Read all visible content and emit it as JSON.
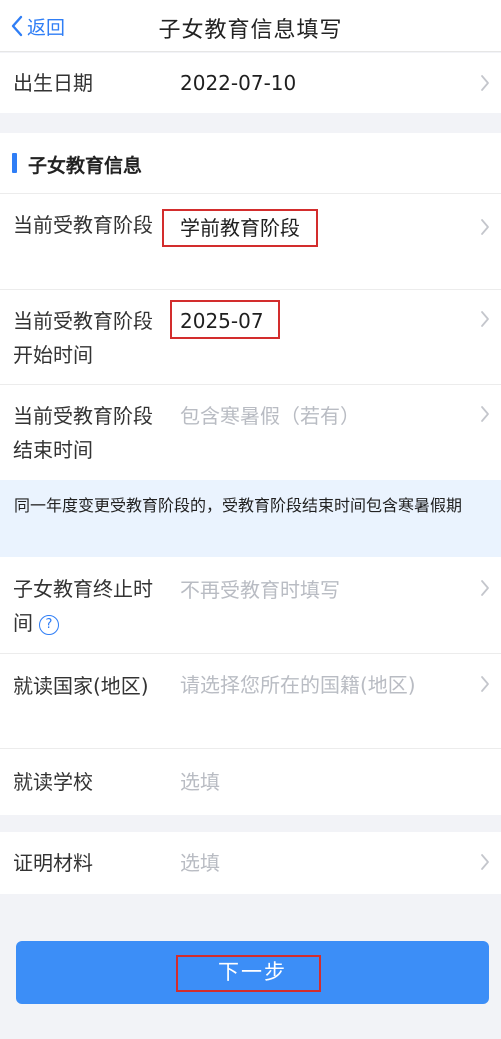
{
  "nav": {
    "back_label": "返回",
    "title": "子女教育信息填写"
  },
  "birth": {
    "label": "出生日期",
    "value": "2022-07-10"
  },
  "section": {
    "title": "子女教育信息"
  },
  "stage": {
    "label": "当前受教育阶段",
    "value": "学前教育阶段"
  },
  "stage_start": {
    "label": "当前受教育阶段开始时间",
    "value": "2025-07"
  },
  "stage_end": {
    "label": "当前受教育阶段结束时间",
    "placeholder": "包含寒暑假（若有）"
  },
  "notice": {
    "text": "同一年度变更受教育阶段的，受教育阶段结束时间包含寒暑假期"
  },
  "terminate": {
    "label": "子女教育终止时间",
    "placeholder": "不再受教育时填写",
    "help": "?"
  },
  "country": {
    "label": "就读国家(地区)",
    "placeholder": "请选择您所在的国籍(地区)"
  },
  "school": {
    "label": "就读学校",
    "placeholder": "选填"
  },
  "proof": {
    "label": "证明材料",
    "placeholder": "选填"
  },
  "next_button": {
    "label": "下一步"
  },
  "colors": {
    "accent": "#2f7ef6",
    "button": "#3c8ef7",
    "highlight": "#d32d2d",
    "notice_bg": "#eaf3fe"
  },
  "icons": {
    "back": "chevron-left-icon",
    "row_arrow": "chevron-right-icon",
    "help": "question-circle-icon"
  }
}
